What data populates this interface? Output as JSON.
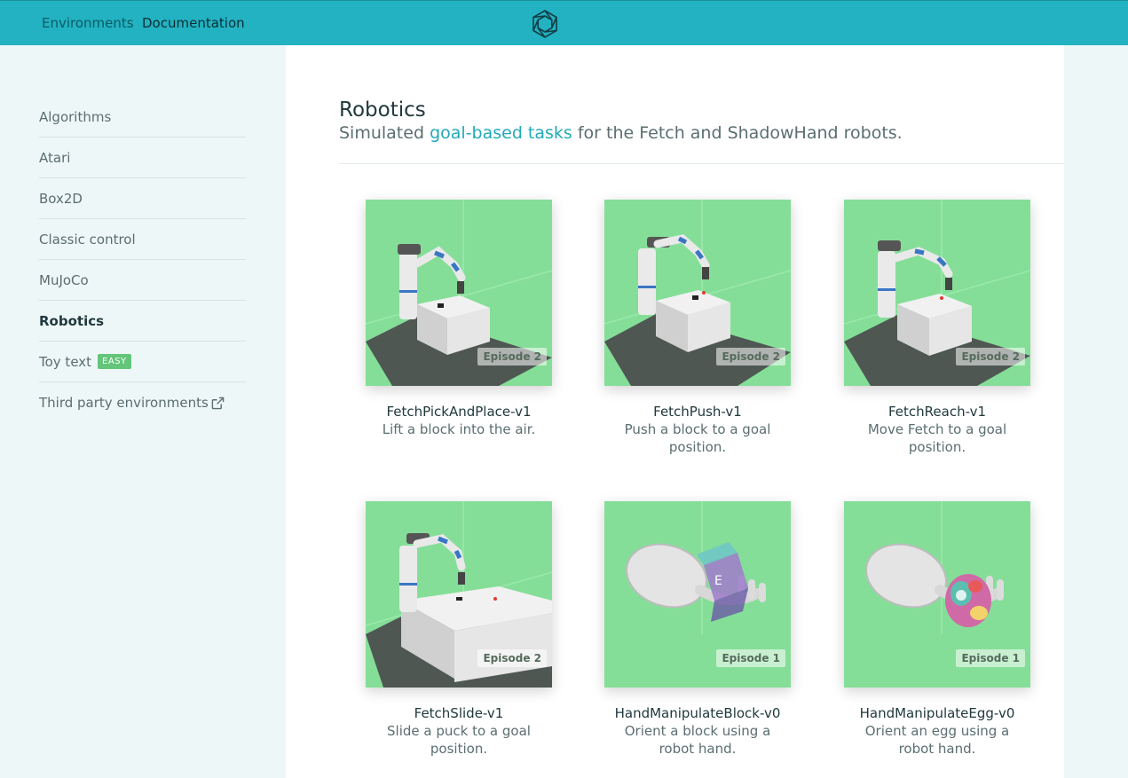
{
  "nav": {
    "environments": "Environments",
    "documentation": "Documentation"
  },
  "sidebar": {
    "items": [
      {
        "label": "Algorithms"
      },
      {
        "label": "Atari"
      },
      {
        "label": "Box2D"
      },
      {
        "label": "Classic control"
      },
      {
        "label": "MuJoCo"
      },
      {
        "label": "Robotics",
        "active": true
      },
      {
        "label": "Toy text",
        "badge": "EASY"
      },
      {
        "label": "Third party environments",
        "external": true
      }
    ]
  },
  "main": {
    "title": "Robotics",
    "subtitle_pre": "Simulated ",
    "subtitle_link": "goal-based tasks",
    "subtitle_post": " for the Fetch and ShadowHand robots."
  },
  "cards": [
    {
      "name": "FetchPickAndPlace-v1",
      "desc": "Lift a block into the air.",
      "episode": "Episode 2",
      "scene": "fetch-pick"
    },
    {
      "name": "FetchPush-v1",
      "desc": "Push a block to a goal position.",
      "episode": "Episode 2",
      "scene": "fetch-push"
    },
    {
      "name": "FetchReach-v1",
      "desc": "Move Fetch to a goal position.",
      "episode": "Episode 2",
      "scene": "fetch-reach"
    },
    {
      "name": "FetchSlide-v1",
      "desc": "Slide a puck to a goal position.",
      "episode": "Episode 2",
      "scene": "fetch-slide"
    },
    {
      "name": "HandManipulateBlock-v0",
      "desc": "Orient a block using a robot hand.",
      "episode": "Episode 1",
      "scene": "hand-block"
    },
    {
      "name": "HandManipulateEgg-v0",
      "desc": "Orient an egg using a robot hand.",
      "episode": "Episode 1",
      "scene": "hand-egg"
    }
  ],
  "colors": {
    "topbar": "#22b2c2",
    "accent": "#22a9b8",
    "thumb_bg": "#82dd96",
    "badge": "#63c57a"
  },
  "icons": {
    "logo": "openai-logo-icon",
    "external": "external-link-icon"
  }
}
